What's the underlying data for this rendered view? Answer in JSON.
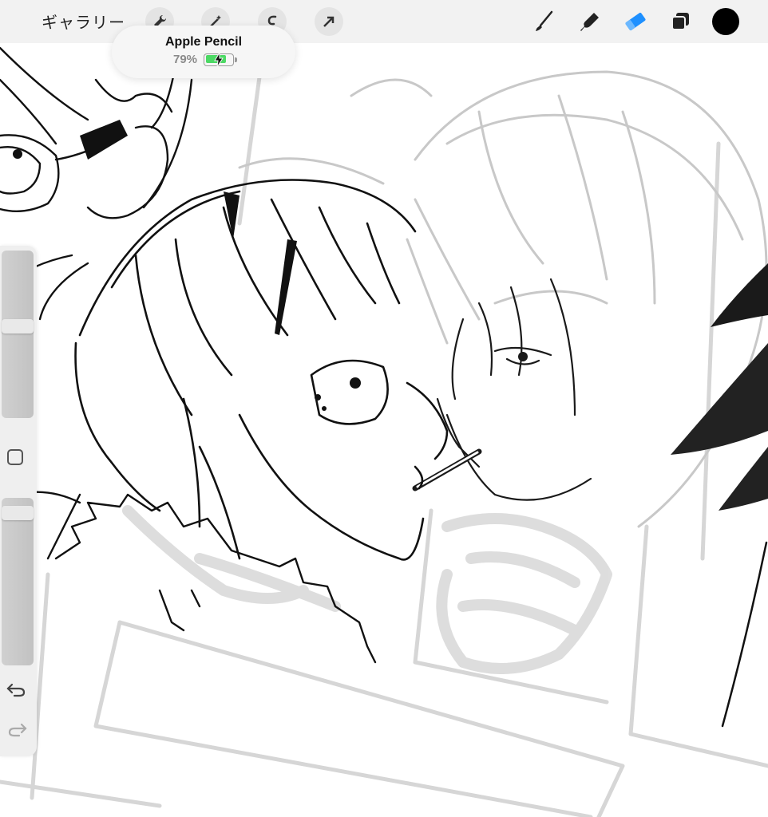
{
  "toolbar": {
    "gallery_label": "ギャラリー",
    "left_tools": [
      "wrench-icon",
      "magic-wand-icon",
      "selection-icon",
      "transform-arrow-icon"
    ],
    "right_tools": [
      "brush-icon",
      "smudge-icon",
      "eraser-icon",
      "layers-icon",
      "color-swatch"
    ],
    "active_tool": "eraser",
    "accent_color": "#1e90ff",
    "current_color": "#000000"
  },
  "pencil_popup": {
    "name": "Apple Pencil",
    "battery_percent": "79%",
    "battery_level": 0.79,
    "charging": true,
    "battery_color": "#4cd964"
  },
  "sidebar": {
    "brush_size_level": 0.55,
    "opacity_level": 0.05,
    "buttons": [
      "modify-square",
      "undo",
      "redo"
    ]
  }
}
